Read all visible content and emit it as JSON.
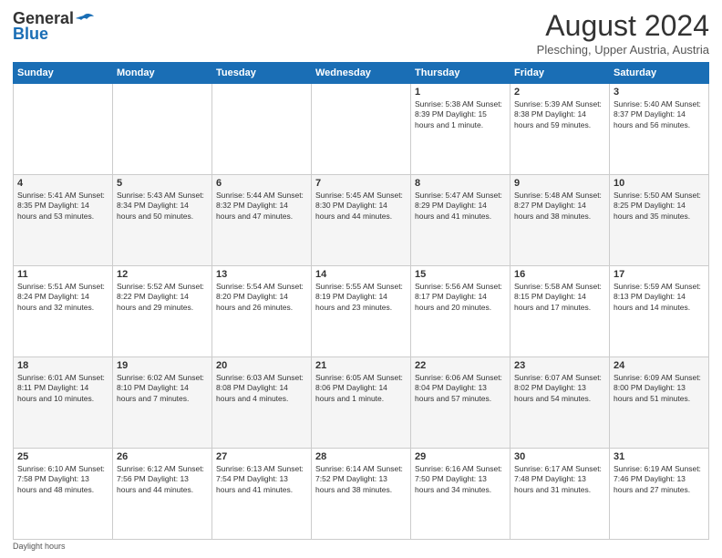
{
  "header": {
    "logo_line1": "General",
    "logo_line2": "Blue",
    "month_title": "August 2024",
    "location": "Plesching, Upper Austria, Austria"
  },
  "days_of_week": [
    "Sunday",
    "Monday",
    "Tuesday",
    "Wednesday",
    "Thursday",
    "Friday",
    "Saturday"
  ],
  "weeks": [
    [
      {
        "day": "",
        "info": ""
      },
      {
        "day": "",
        "info": ""
      },
      {
        "day": "",
        "info": ""
      },
      {
        "day": "",
        "info": ""
      },
      {
        "day": "1",
        "info": "Sunrise: 5:38 AM\nSunset: 8:39 PM\nDaylight: 15 hours\nand 1 minute."
      },
      {
        "day": "2",
        "info": "Sunrise: 5:39 AM\nSunset: 8:38 PM\nDaylight: 14 hours\nand 59 minutes."
      },
      {
        "day": "3",
        "info": "Sunrise: 5:40 AM\nSunset: 8:37 PM\nDaylight: 14 hours\nand 56 minutes."
      }
    ],
    [
      {
        "day": "4",
        "info": "Sunrise: 5:41 AM\nSunset: 8:35 PM\nDaylight: 14 hours\nand 53 minutes."
      },
      {
        "day": "5",
        "info": "Sunrise: 5:43 AM\nSunset: 8:34 PM\nDaylight: 14 hours\nand 50 minutes."
      },
      {
        "day": "6",
        "info": "Sunrise: 5:44 AM\nSunset: 8:32 PM\nDaylight: 14 hours\nand 47 minutes."
      },
      {
        "day": "7",
        "info": "Sunrise: 5:45 AM\nSunset: 8:30 PM\nDaylight: 14 hours\nand 44 minutes."
      },
      {
        "day": "8",
        "info": "Sunrise: 5:47 AM\nSunset: 8:29 PM\nDaylight: 14 hours\nand 41 minutes."
      },
      {
        "day": "9",
        "info": "Sunrise: 5:48 AM\nSunset: 8:27 PM\nDaylight: 14 hours\nand 38 minutes."
      },
      {
        "day": "10",
        "info": "Sunrise: 5:50 AM\nSunset: 8:25 PM\nDaylight: 14 hours\nand 35 minutes."
      }
    ],
    [
      {
        "day": "11",
        "info": "Sunrise: 5:51 AM\nSunset: 8:24 PM\nDaylight: 14 hours\nand 32 minutes."
      },
      {
        "day": "12",
        "info": "Sunrise: 5:52 AM\nSunset: 8:22 PM\nDaylight: 14 hours\nand 29 minutes."
      },
      {
        "day": "13",
        "info": "Sunrise: 5:54 AM\nSunset: 8:20 PM\nDaylight: 14 hours\nand 26 minutes."
      },
      {
        "day": "14",
        "info": "Sunrise: 5:55 AM\nSunset: 8:19 PM\nDaylight: 14 hours\nand 23 minutes."
      },
      {
        "day": "15",
        "info": "Sunrise: 5:56 AM\nSunset: 8:17 PM\nDaylight: 14 hours\nand 20 minutes."
      },
      {
        "day": "16",
        "info": "Sunrise: 5:58 AM\nSunset: 8:15 PM\nDaylight: 14 hours\nand 17 minutes."
      },
      {
        "day": "17",
        "info": "Sunrise: 5:59 AM\nSunset: 8:13 PM\nDaylight: 14 hours\nand 14 minutes."
      }
    ],
    [
      {
        "day": "18",
        "info": "Sunrise: 6:01 AM\nSunset: 8:11 PM\nDaylight: 14 hours\nand 10 minutes."
      },
      {
        "day": "19",
        "info": "Sunrise: 6:02 AM\nSunset: 8:10 PM\nDaylight: 14 hours\nand 7 minutes."
      },
      {
        "day": "20",
        "info": "Sunrise: 6:03 AM\nSunset: 8:08 PM\nDaylight: 14 hours\nand 4 minutes."
      },
      {
        "day": "21",
        "info": "Sunrise: 6:05 AM\nSunset: 8:06 PM\nDaylight: 14 hours\nand 1 minute."
      },
      {
        "day": "22",
        "info": "Sunrise: 6:06 AM\nSunset: 8:04 PM\nDaylight: 13 hours\nand 57 minutes."
      },
      {
        "day": "23",
        "info": "Sunrise: 6:07 AM\nSunset: 8:02 PM\nDaylight: 13 hours\nand 54 minutes."
      },
      {
        "day": "24",
        "info": "Sunrise: 6:09 AM\nSunset: 8:00 PM\nDaylight: 13 hours\nand 51 minutes."
      }
    ],
    [
      {
        "day": "25",
        "info": "Sunrise: 6:10 AM\nSunset: 7:58 PM\nDaylight: 13 hours\nand 48 minutes."
      },
      {
        "day": "26",
        "info": "Sunrise: 6:12 AM\nSunset: 7:56 PM\nDaylight: 13 hours\nand 44 minutes."
      },
      {
        "day": "27",
        "info": "Sunrise: 6:13 AM\nSunset: 7:54 PM\nDaylight: 13 hours\nand 41 minutes."
      },
      {
        "day": "28",
        "info": "Sunrise: 6:14 AM\nSunset: 7:52 PM\nDaylight: 13 hours\nand 38 minutes."
      },
      {
        "day": "29",
        "info": "Sunrise: 6:16 AM\nSunset: 7:50 PM\nDaylight: 13 hours\nand 34 minutes."
      },
      {
        "day": "30",
        "info": "Sunrise: 6:17 AM\nSunset: 7:48 PM\nDaylight: 13 hours\nand 31 minutes."
      },
      {
        "day": "31",
        "info": "Sunrise: 6:19 AM\nSunset: 7:46 PM\nDaylight: 13 hours\nand 27 minutes."
      }
    ]
  ],
  "footer": {
    "note": "Daylight hours"
  }
}
